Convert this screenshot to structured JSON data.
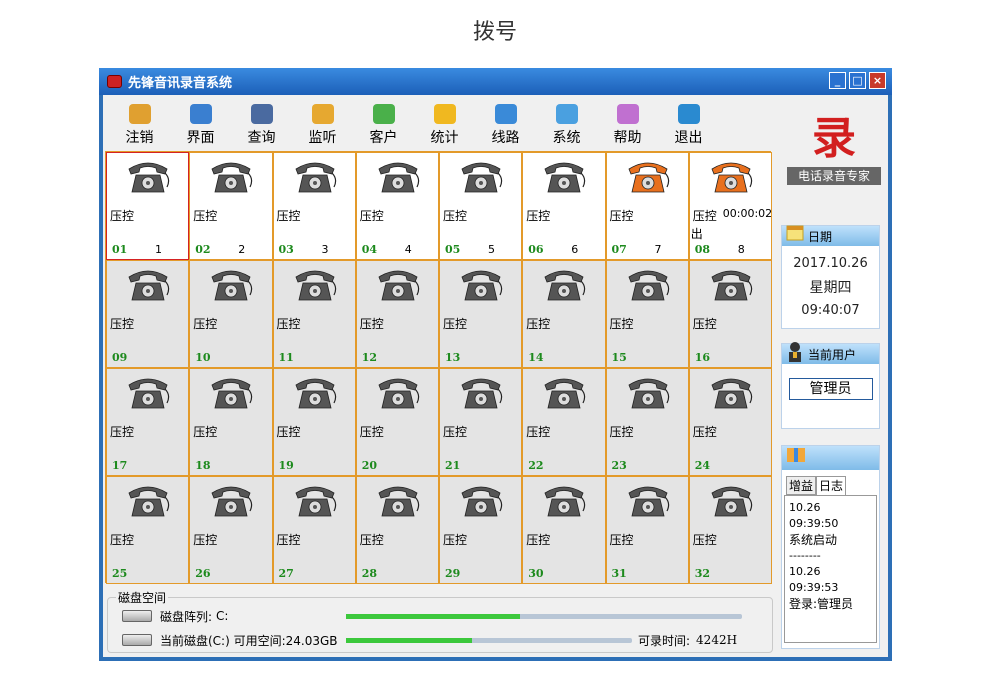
{
  "caption": "拨号",
  "window": {
    "title": "先锋音讯录音系统",
    "min_label": "_",
    "max_label": "□",
    "close_label": "×"
  },
  "toolbar": [
    {
      "label": "注销",
      "icon": "user-logout-icon",
      "color": "#e0a030"
    },
    {
      "label": "界面",
      "icon": "window-icon",
      "color": "#3a7fd0"
    },
    {
      "label": "查询",
      "icon": "search-icon",
      "color": "#4a6aa0"
    },
    {
      "label": "监听",
      "icon": "headset-icon",
      "color": "#e6a830"
    },
    {
      "label": "客户",
      "icon": "customer-icon",
      "color": "#4ab04a"
    },
    {
      "label": "统计",
      "icon": "bar-chart-icon",
      "color": "#f0b820"
    },
    {
      "label": "线路",
      "icon": "line-icon",
      "color": "#3a8ad8"
    },
    {
      "label": "系统",
      "icon": "system-icon",
      "color": "#4aa0e0"
    },
    {
      "label": "帮助",
      "icon": "help-book-icon",
      "color": "#c070d0"
    },
    {
      "label": "退出",
      "icon": "exit-icon",
      "color": "#2a8ad0"
    }
  ],
  "lines": [
    {
      "num": "01",
      "ext": "1",
      "status": "压控",
      "active": false,
      "selected": true
    },
    {
      "num": "02",
      "ext": "2",
      "status": "压控",
      "active": false
    },
    {
      "num": "03",
      "ext": "3",
      "status": "压控",
      "active": false
    },
    {
      "num": "04",
      "ext": "4",
      "status": "压控",
      "active": false
    },
    {
      "num": "05",
      "ext": "5",
      "status": "压控",
      "active": false
    },
    {
      "num": "06",
      "ext": "6",
      "status": "压控",
      "active": false
    },
    {
      "num": "07",
      "ext": "7",
      "status": "压控",
      "active": true
    },
    {
      "num": "08",
      "ext": "8",
      "status": "压控",
      "active": true,
      "time": "00:00:02",
      "status2": "出"
    },
    {
      "num": "09",
      "ext": "",
      "status": "压控"
    },
    {
      "num": "10",
      "ext": "",
      "status": "压控"
    },
    {
      "num": "11",
      "ext": "",
      "status": "压控"
    },
    {
      "num": "12",
      "ext": "",
      "status": "压控"
    },
    {
      "num": "13",
      "ext": "",
      "status": "压控"
    },
    {
      "num": "14",
      "ext": "",
      "status": "压控"
    },
    {
      "num": "15",
      "ext": "",
      "status": "压控"
    },
    {
      "num": "16",
      "ext": "",
      "status": "压控"
    },
    {
      "num": "17",
      "ext": "",
      "status": "压控"
    },
    {
      "num": "18",
      "ext": "",
      "status": "压控"
    },
    {
      "num": "19",
      "ext": "",
      "status": "压控"
    },
    {
      "num": "20",
      "ext": "",
      "status": "压控"
    },
    {
      "num": "21",
      "ext": "",
      "status": "压控"
    },
    {
      "num": "22",
      "ext": "",
      "status": "压控"
    },
    {
      "num": "23",
      "ext": "",
      "status": "压控"
    },
    {
      "num": "24",
      "ext": "",
      "status": "压控"
    },
    {
      "num": "25",
      "ext": "",
      "status": "压控"
    },
    {
      "num": "26",
      "ext": "",
      "status": "压控"
    },
    {
      "num": "27",
      "ext": "",
      "status": "压控"
    },
    {
      "num": "28",
      "ext": "",
      "status": "压控"
    },
    {
      "num": "29",
      "ext": "",
      "status": "压控"
    },
    {
      "num": "30",
      "ext": "",
      "status": "压控"
    },
    {
      "num": "31",
      "ext": "",
      "status": "压控"
    },
    {
      "num": "32",
      "ext": "",
      "status": "压控"
    }
  ],
  "disk": {
    "legend": "磁盘空间",
    "array_label": "磁盘阵列:",
    "array_value": "C:",
    "current_label": "当前磁盘(C:) 可用空间:24.03GB",
    "record_label": "可录时间:",
    "record_value": "4242H",
    "array_fill": 0.44,
    "current_fill": 0.44
  },
  "logo": {
    "seal": "录",
    "tag": "电话录音专家"
  },
  "date_panel": {
    "title": "日期",
    "date": "2017.10.26",
    "weekday": "星期四",
    "time": "09:40:07"
  },
  "user_panel": {
    "title": "当前用户",
    "user": "管理员"
  },
  "log_panel": {
    "tabs": [
      "增益",
      "日志"
    ],
    "entries": [
      {
        "date": "10.26",
        "time": "09:39:50",
        "msg": "系统启动",
        "sep": "--------"
      },
      {
        "date": "10.26",
        "time": "09:39:53",
        "msg": "登录:管理员"
      }
    ]
  },
  "colors": {
    "accent": "#2d6fb6",
    "grid_border": "#e39a2a",
    "line_number": "#1d8a1d",
    "phone_idle": "#555555",
    "phone_active": "#e8701e"
  }
}
